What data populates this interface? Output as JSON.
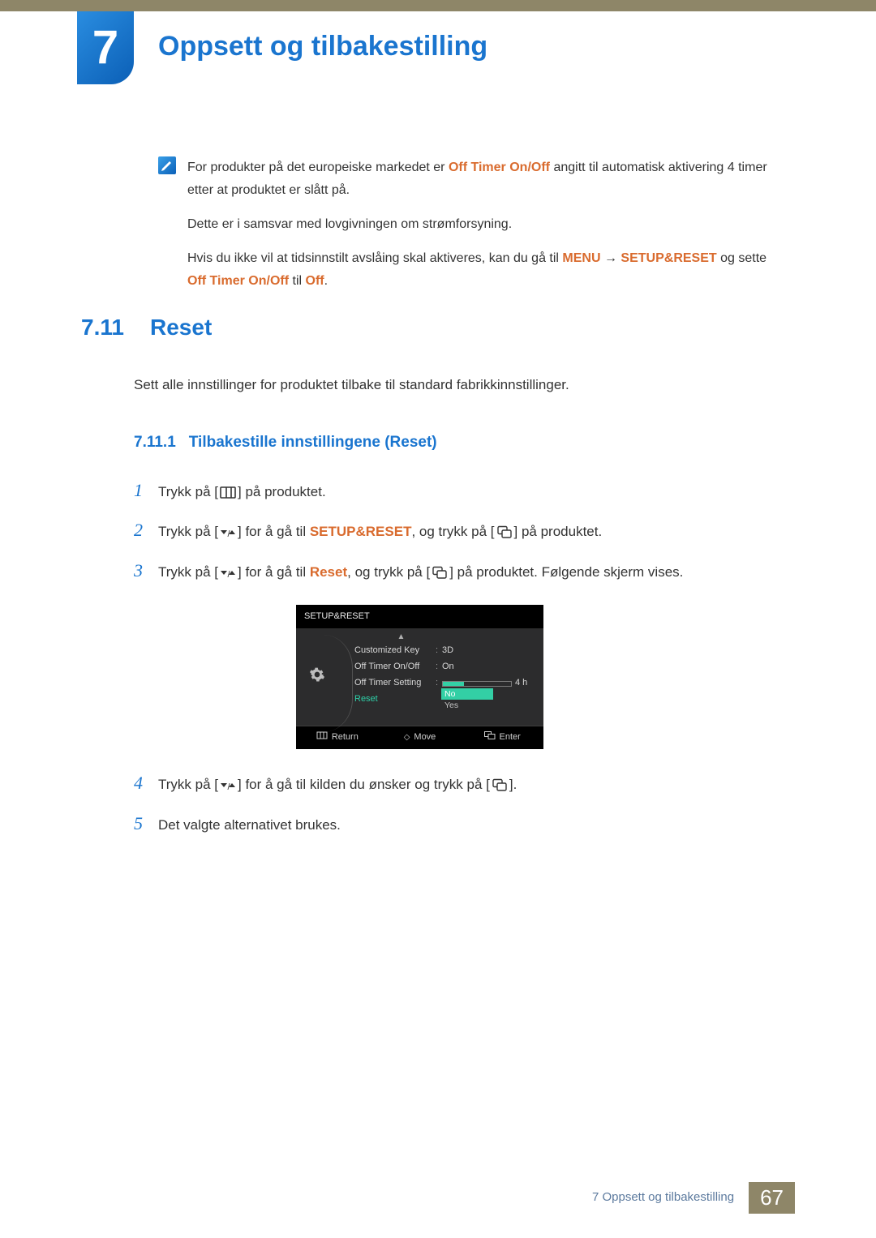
{
  "chapter": {
    "number": "7",
    "title": "Oppsett og tilbakestilling"
  },
  "note": {
    "p1a": "For produkter på det europeiske markedet er ",
    "p1_hl1": "Off Timer On/Off",
    "p1b": " angitt til automatisk aktivering 4 timer etter at produktet er slått på.",
    "p2": "Dette er i samsvar med lovgivningen om strømforsyning.",
    "p3a": "Hvis du ikke vil at tidsinnstilt avslåing skal aktiveres, kan du gå til ",
    "p3_hl_menu": "MENU",
    "p3_arrow": " → ",
    "p3_hl_setup": "SETUP&RESET",
    "p3b": " og sette ",
    "p3_hl_off1": "Off Timer On/Off",
    "p3c": " til ",
    "p3_hl_off2": "Off",
    "p3d": "."
  },
  "section": {
    "num": "7.11",
    "title": "Reset",
    "desc": "Sett alle innstillinger for produktet tilbake til standard fabrikkinnstillinger.",
    "sub_num": "7.11.1",
    "sub_title": "Tilbakestille innstillingene (Reset)"
  },
  "steps": {
    "s1": {
      "n": "1",
      "a": "Trykk på [",
      "b": "] på produktet."
    },
    "s2": {
      "n": "2",
      "a": "Trykk på [",
      "b": "] for å gå til ",
      "hl": "SETUP&RESET",
      "c": ", og trykk på [",
      "d": "] på produktet."
    },
    "s3": {
      "n": "3",
      "a": "Trykk på [",
      "b": "] for å gå til ",
      "hl": "Reset",
      "c": ", og trykk på [",
      "d": "] på produktet. Følgende skjerm vises."
    },
    "s4": {
      "n": "4",
      "a": "Trykk på [",
      "b": "] for å gå til kilden du ønsker og trykk på [",
      "c": "]."
    },
    "s5": {
      "n": "5",
      "a": "Det valgte alternativet brukes."
    }
  },
  "osd": {
    "title": "SETUP&RESET",
    "rows": {
      "r1": {
        "label": "Customized Key",
        "val": "3D"
      },
      "r2": {
        "label": "Off Timer On/Off",
        "val": "On"
      },
      "r3": {
        "label": "Off Timer Setting",
        "val": "4 h"
      },
      "r4": {
        "label": "Reset"
      }
    },
    "opts": {
      "no": "No",
      "yes": "Yes"
    },
    "footer": {
      "return": "Return",
      "move": "Move",
      "enter": "Enter"
    }
  },
  "footer": {
    "text": "7 Oppsett og tilbakestilling",
    "page": "67"
  }
}
